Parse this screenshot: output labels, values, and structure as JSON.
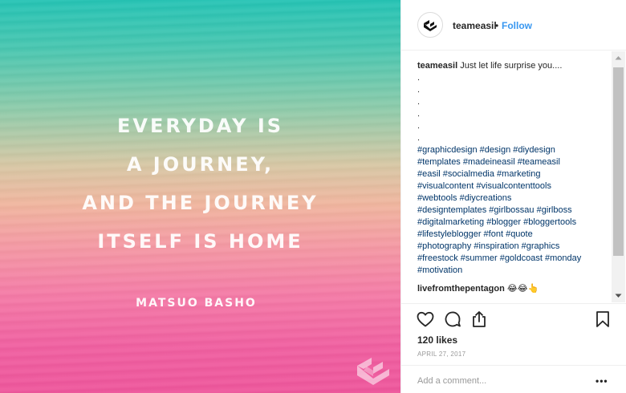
{
  "post": {
    "quote_lines": [
      "EVERYDAY IS",
      "A JOURNEY,",
      "AND THE JOURNEY",
      "ITSELF IS HOME"
    ],
    "author": "MATSUO BASHO",
    "watermark_icon": "easil-logo-icon"
  },
  "header": {
    "username": "teameasil",
    "separator": "•",
    "follow_label": "Follow",
    "avatar_icon": "easil-logo-icon"
  },
  "caption": {
    "username": "teameasil",
    "text": "Just let life surprise you....",
    "dots": [
      ".",
      ".",
      ".",
      ".",
      ".",
      "."
    ],
    "hashtag_lines": [
      "#graphicdesign #design #diydesign",
      "#templates #madeineasil #teameasil",
      "#easil #socialmedia #marketing",
      "#visualcontent #visualcontenttools",
      "#webtools #diycreations",
      "#designtemplates #girlbossau #girlboss",
      "#digitalmarketing #blogger #bloggertools",
      "#lifestyleblogger #font #quote",
      "#photography #inspiration #graphics",
      "#freestock #summer #goldcoast #monday",
      "#motivation"
    ]
  },
  "reply": {
    "username": "livefromthepentagon",
    "text": "😂😂👆"
  },
  "actions": {
    "like_icon": "heart-icon",
    "comment_icon": "comment-icon",
    "share_icon": "share-icon",
    "save_icon": "bookmark-icon"
  },
  "likes": "120 likes",
  "date": "APRIL 27, 2017",
  "comment_box": {
    "placeholder": "Add a comment...",
    "more_label": "•••"
  },
  "colors": {
    "link": "#3897f0",
    "hashtag": "#003569",
    "gradient_top": "#25c3b4",
    "gradient_bottom": "#ee559b"
  }
}
